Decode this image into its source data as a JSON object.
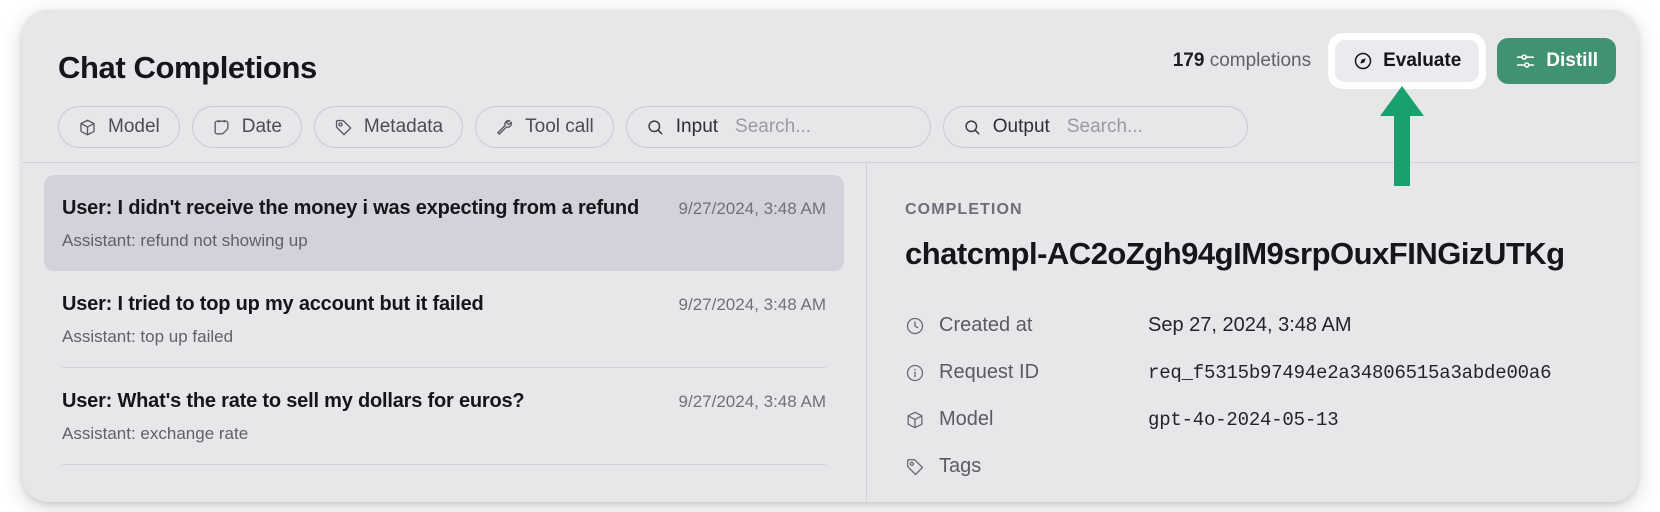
{
  "header": {
    "title": "Chat Completions",
    "count_number": "179",
    "count_label": "completions",
    "evaluate_label": "Evaluate",
    "distill_label": "Distill",
    "evaluate_icon": "compass-icon",
    "distill_icon": "sliders-icon",
    "accent_green": "#3f9272",
    "annotation_arrow_color": "#1aa06d"
  },
  "filters": {
    "chips": [
      {
        "label": "Model",
        "icon": "cube-icon"
      },
      {
        "label": "Date",
        "icon": "calendar-icon"
      },
      {
        "label": "Metadata",
        "icon": "tag-icon"
      },
      {
        "label": "Tool call",
        "icon": "wrench-icon"
      }
    ],
    "searches": [
      {
        "label": "Input",
        "placeholder": "Search...",
        "icon": "search-icon"
      },
      {
        "label": "Output",
        "placeholder": "Search...",
        "icon": "search-icon"
      }
    ]
  },
  "list": {
    "items": [
      {
        "title": "User: I didn't receive the money i was expecting from a refund",
        "subtitle": "Assistant: refund not showing up",
        "date": "9/27/2024, 3:48 AM",
        "selected": true
      },
      {
        "title": "User: I tried to top up my account but it failed",
        "subtitle": "Assistant: top up failed",
        "date": "9/27/2024, 3:48 AM",
        "selected": false
      },
      {
        "title": "User: What's the rate to sell my dollars for euros?",
        "subtitle": "Assistant: exchange rate",
        "date": "9/27/2024, 3:48 AM",
        "selected": false
      }
    ]
  },
  "detail": {
    "kicker": "COMPLETION",
    "completion_id": "chatcmpl-AC2oZgh94gIM9srpOuxFINGizUTKg",
    "rows": [
      {
        "key": "Created at",
        "value": "Sep 27, 2024, 3:48 AM",
        "icon": "clock-icon",
        "mono": false
      },
      {
        "key": "Request ID",
        "value": "req_f5315b97494e2a34806515a3abde00a6",
        "icon": "info-icon",
        "mono": true
      },
      {
        "key": "Model",
        "value": "gpt-4o-2024-05-13",
        "icon": "cube-icon",
        "mono": true
      },
      {
        "key": "Tags",
        "value": "",
        "icon": "tag-icon",
        "mono": false
      }
    ]
  }
}
